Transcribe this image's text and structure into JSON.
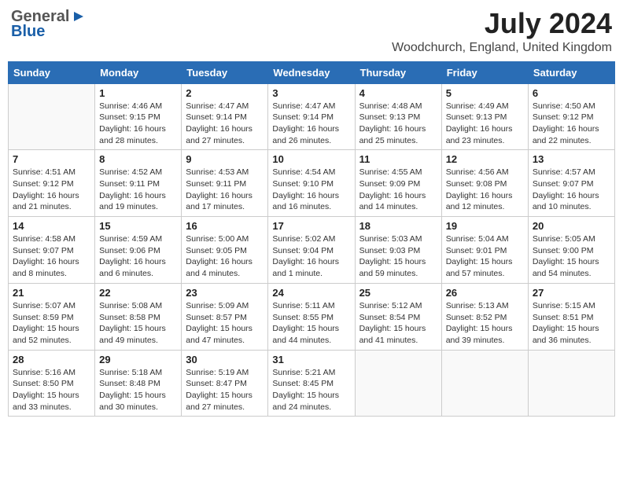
{
  "header": {
    "logo_line1": "General",
    "logo_line2": "Blue",
    "month_title": "July 2024",
    "location": "Woodchurch, England, United Kingdom"
  },
  "days_of_week": [
    "Sunday",
    "Monday",
    "Tuesday",
    "Wednesday",
    "Thursday",
    "Friday",
    "Saturday"
  ],
  "weeks": [
    [
      {
        "day": "",
        "sunrise": "",
        "sunset": "",
        "daylight": ""
      },
      {
        "day": "1",
        "sunrise": "Sunrise: 4:46 AM",
        "sunset": "Sunset: 9:15 PM",
        "daylight": "Daylight: 16 hours and 28 minutes."
      },
      {
        "day": "2",
        "sunrise": "Sunrise: 4:47 AM",
        "sunset": "Sunset: 9:14 PM",
        "daylight": "Daylight: 16 hours and 27 minutes."
      },
      {
        "day": "3",
        "sunrise": "Sunrise: 4:47 AM",
        "sunset": "Sunset: 9:14 PM",
        "daylight": "Daylight: 16 hours and 26 minutes."
      },
      {
        "day": "4",
        "sunrise": "Sunrise: 4:48 AM",
        "sunset": "Sunset: 9:13 PM",
        "daylight": "Daylight: 16 hours and 25 minutes."
      },
      {
        "day": "5",
        "sunrise": "Sunrise: 4:49 AM",
        "sunset": "Sunset: 9:13 PM",
        "daylight": "Daylight: 16 hours and 23 minutes."
      },
      {
        "day": "6",
        "sunrise": "Sunrise: 4:50 AM",
        "sunset": "Sunset: 9:12 PM",
        "daylight": "Daylight: 16 hours and 22 minutes."
      }
    ],
    [
      {
        "day": "7",
        "sunrise": "Sunrise: 4:51 AM",
        "sunset": "Sunset: 9:12 PM",
        "daylight": "Daylight: 16 hours and 21 minutes."
      },
      {
        "day": "8",
        "sunrise": "Sunrise: 4:52 AM",
        "sunset": "Sunset: 9:11 PM",
        "daylight": "Daylight: 16 hours and 19 minutes."
      },
      {
        "day": "9",
        "sunrise": "Sunrise: 4:53 AM",
        "sunset": "Sunset: 9:11 PM",
        "daylight": "Daylight: 16 hours and 17 minutes."
      },
      {
        "day": "10",
        "sunrise": "Sunrise: 4:54 AM",
        "sunset": "Sunset: 9:10 PM",
        "daylight": "Daylight: 16 hours and 16 minutes."
      },
      {
        "day": "11",
        "sunrise": "Sunrise: 4:55 AM",
        "sunset": "Sunset: 9:09 PM",
        "daylight": "Daylight: 16 hours and 14 minutes."
      },
      {
        "day": "12",
        "sunrise": "Sunrise: 4:56 AM",
        "sunset": "Sunset: 9:08 PM",
        "daylight": "Daylight: 16 hours and 12 minutes."
      },
      {
        "day": "13",
        "sunrise": "Sunrise: 4:57 AM",
        "sunset": "Sunset: 9:07 PM",
        "daylight": "Daylight: 16 hours and 10 minutes."
      }
    ],
    [
      {
        "day": "14",
        "sunrise": "Sunrise: 4:58 AM",
        "sunset": "Sunset: 9:07 PM",
        "daylight": "Daylight: 16 hours and 8 minutes."
      },
      {
        "day": "15",
        "sunrise": "Sunrise: 4:59 AM",
        "sunset": "Sunset: 9:06 PM",
        "daylight": "Daylight: 16 hours and 6 minutes."
      },
      {
        "day": "16",
        "sunrise": "Sunrise: 5:00 AM",
        "sunset": "Sunset: 9:05 PM",
        "daylight": "Daylight: 16 hours and 4 minutes."
      },
      {
        "day": "17",
        "sunrise": "Sunrise: 5:02 AM",
        "sunset": "Sunset: 9:04 PM",
        "daylight": "Daylight: 16 hours and 1 minute."
      },
      {
        "day": "18",
        "sunrise": "Sunrise: 5:03 AM",
        "sunset": "Sunset: 9:03 PM",
        "daylight": "Daylight: 15 hours and 59 minutes."
      },
      {
        "day": "19",
        "sunrise": "Sunrise: 5:04 AM",
        "sunset": "Sunset: 9:01 PM",
        "daylight": "Daylight: 15 hours and 57 minutes."
      },
      {
        "day": "20",
        "sunrise": "Sunrise: 5:05 AM",
        "sunset": "Sunset: 9:00 PM",
        "daylight": "Daylight: 15 hours and 54 minutes."
      }
    ],
    [
      {
        "day": "21",
        "sunrise": "Sunrise: 5:07 AM",
        "sunset": "Sunset: 8:59 PM",
        "daylight": "Daylight: 15 hours and 52 minutes."
      },
      {
        "day": "22",
        "sunrise": "Sunrise: 5:08 AM",
        "sunset": "Sunset: 8:58 PM",
        "daylight": "Daylight: 15 hours and 49 minutes."
      },
      {
        "day": "23",
        "sunrise": "Sunrise: 5:09 AM",
        "sunset": "Sunset: 8:57 PM",
        "daylight": "Daylight: 15 hours and 47 minutes."
      },
      {
        "day": "24",
        "sunrise": "Sunrise: 5:11 AM",
        "sunset": "Sunset: 8:55 PM",
        "daylight": "Daylight: 15 hours and 44 minutes."
      },
      {
        "day": "25",
        "sunrise": "Sunrise: 5:12 AM",
        "sunset": "Sunset: 8:54 PM",
        "daylight": "Daylight: 15 hours and 41 minutes."
      },
      {
        "day": "26",
        "sunrise": "Sunrise: 5:13 AM",
        "sunset": "Sunset: 8:52 PM",
        "daylight": "Daylight: 15 hours and 39 minutes."
      },
      {
        "day": "27",
        "sunrise": "Sunrise: 5:15 AM",
        "sunset": "Sunset: 8:51 PM",
        "daylight": "Daylight: 15 hours and 36 minutes."
      }
    ],
    [
      {
        "day": "28",
        "sunrise": "Sunrise: 5:16 AM",
        "sunset": "Sunset: 8:50 PM",
        "daylight": "Daylight: 15 hours and 33 minutes."
      },
      {
        "day": "29",
        "sunrise": "Sunrise: 5:18 AM",
        "sunset": "Sunset: 8:48 PM",
        "daylight": "Daylight: 15 hours and 30 minutes."
      },
      {
        "day": "30",
        "sunrise": "Sunrise: 5:19 AM",
        "sunset": "Sunset: 8:47 PM",
        "daylight": "Daylight: 15 hours and 27 minutes."
      },
      {
        "day": "31",
        "sunrise": "Sunrise: 5:21 AM",
        "sunset": "Sunset: 8:45 PM",
        "daylight": "Daylight: 15 hours and 24 minutes."
      },
      {
        "day": "",
        "sunrise": "",
        "sunset": "",
        "daylight": ""
      },
      {
        "day": "",
        "sunrise": "",
        "sunset": "",
        "daylight": ""
      },
      {
        "day": "",
        "sunrise": "",
        "sunset": "",
        "daylight": ""
      }
    ]
  ]
}
